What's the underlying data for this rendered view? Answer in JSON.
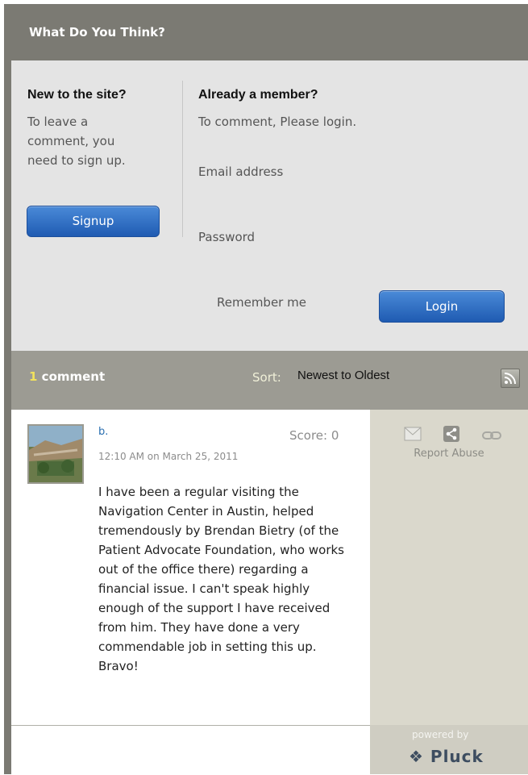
{
  "header": {
    "title": "What Do You Think?"
  },
  "new_user": {
    "heading": "New to the site?",
    "text_lines": [
      "To leave a",
      "comment, you",
      "need to sign up."
    ],
    "signup_label": "Signup"
  },
  "member": {
    "heading": "Already a member?",
    "text": "To comment, Please login.",
    "email_label": "Email address",
    "password_label": "Password",
    "remember_label": "Remember me",
    "login_label": "Login"
  },
  "comments_bar": {
    "count": "1",
    "count_label": "comment",
    "sort_label": "Sort:",
    "sort_value": "Newest to Oldest",
    "rss_icon": "rss-icon"
  },
  "comment": {
    "author": "b.",
    "score": "Score: 0",
    "timestamp": "12:10 AM on March 25, 2011",
    "body": "I have been a regular visiting the Navigation Center in Austin, helped tremendously by Brendan Bietry (of the Patient Advocate Foundation, who works out of the office there) regarding a financial issue. I can't speak highly enough of the support I have received from him. They have done a very commendable job in setting this up. Bravo!",
    "actions": {
      "report_label": "Report Abuse"
    }
  },
  "branding": {
    "powered_by": "powered by",
    "logo_text": "Pluck"
  },
  "colors": {
    "accent_blue": "#2a6fb0",
    "count_yellow": "#f2e25c",
    "header_bg": "#7b7a73"
  }
}
